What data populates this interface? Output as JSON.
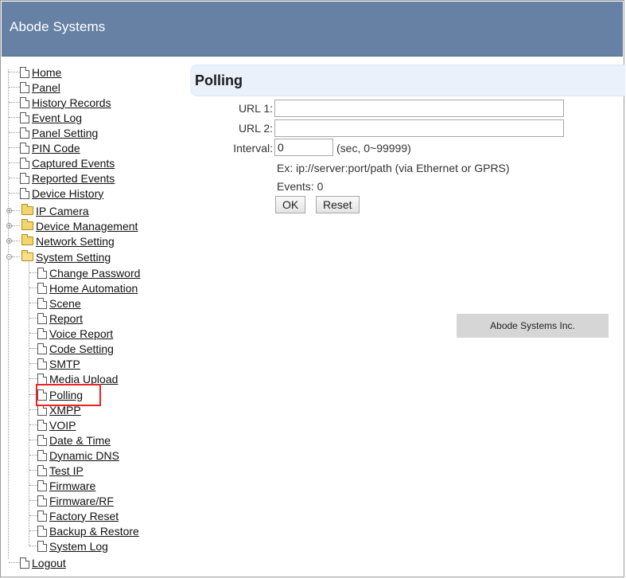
{
  "header": {
    "brand": "Abode Systems"
  },
  "tree": {
    "top_items": [
      "Home",
      "Panel",
      "History Records",
      "Event Log",
      "Panel Setting",
      "PIN Code",
      "Captured Events",
      "Reported Events",
      "Device History"
    ],
    "folders": [
      "IP Camera",
      "Device Management",
      "Network Setting",
      "System Setting"
    ],
    "system_setting_items": [
      "Change Password",
      "Home Automation",
      "Scene",
      "Report",
      "Voice Report",
      "Code Setting",
      "SMTP",
      "Media Upload",
      "Polling",
      "XMPP",
      "VOIP",
      "Date & Time",
      "Dynamic DNS",
      "Test IP",
      "Firmware",
      "Firmware/RF",
      "Factory Reset",
      "Backup & Restore",
      "System Log"
    ],
    "logout": "Logout",
    "plus": "+",
    "minus": "−"
  },
  "main": {
    "title": "Polling",
    "url1_label": "URL 1:",
    "url1_value": "",
    "url2_label": "URL 2:",
    "url2_value": "",
    "interval_label": "Interval:",
    "interval_value": "0",
    "interval_hint": "(sec, 0~99999)",
    "example": "Ex: ip://server:port/path (via Ethernet or GPRS)",
    "events": "Events: 0",
    "ok": "OK",
    "reset": "Reset"
  },
  "footer": {
    "company": "Abode Systems Inc."
  }
}
